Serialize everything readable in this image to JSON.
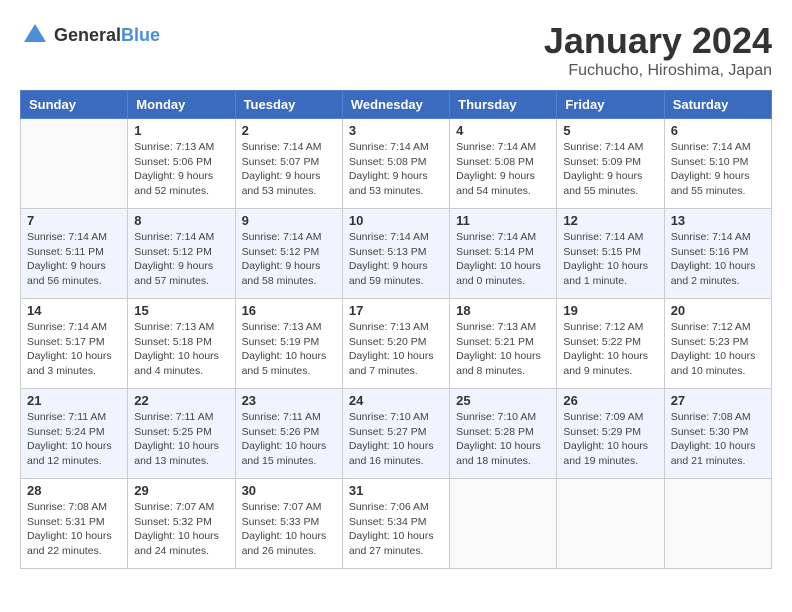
{
  "logo": {
    "text_general": "General",
    "text_blue": "Blue"
  },
  "title": "January 2024",
  "location": "Fuchucho, Hiroshima, Japan",
  "days_of_week": [
    "Sunday",
    "Monday",
    "Tuesday",
    "Wednesday",
    "Thursday",
    "Friday",
    "Saturday"
  ],
  "weeks": [
    [
      {
        "day": "",
        "info": ""
      },
      {
        "day": "1",
        "info": "Sunrise: 7:13 AM\nSunset: 5:06 PM\nDaylight: 9 hours\nand 52 minutes."
      },
      {
        "day": "2",
        "info": "Sunrise: 7:14 AM\nSunset: 5:07 PM\nDaylight: 9 hours\nand 53 minutes."
      },
      {
        "day": "3",
        "info": "Sunrise: 7:14 AM\nSunset: 5:08 PM\nDaylight: 9 hours\nand 53 minutes."
      },
      {
        "day": "4",
        "info": "Sunrise: 7:14 AM\nSunset: 5:08 PM\nDaylight: 9 hours\nand 54 minutes."
      },
      {
        "day": "5",
        "info": "Sunrise: 7:14 AM\nSunset: 5:09 PM\nDaylight: 9 hours\nand 55 minutes."
      },
      {
        "day": "6",
        "info": "Sunrise: 7:14 AM\nSunset: 5:10 PM\nDaylight: 9 hours\nand 55 minutes."
      }
    ],
    [
      {
        "day": "7",
        "info": "Sunrise: 7:14 AM\nSunset: 5:11 PM\nDaylight: 9 hours\nand 56 minutes."
      },
      {
        "day": "8",
        "info": "Sunrise: 7:14 AM\nSunset: 5:12 PM\nDaylight: 9 hours\nand 57 minutes."
      },
      {
        "day": "9",
        "info": "Sunrise: 7:14 AM\nSunset: 5:12 PM\nDaylight: 9 hours\nand 58 minutes."
      },
      {
        "day": "10",
        "info": "Sunrise: 7:14 AM\nSunset: 5:13 PM\nDaylight: 9 hours\nand 59 minutes."
      },
      {
        "day": "11",
        "info": "Sunrise: 7:14 AM\nSunset: 5:14 PM\nDaylight: 10 hours\nand 0 minutes."
      },
      {
        "day": "12",
        "info": "Sunrise: 7:14 AM\nSunset: 5:15 PM\nDaylight: 10 hours\nand 1 minute."
      },
      {
        "day": "13",
        "info": "Sunrise: 7:14 AM\nSunset: 5:16 PM\nDaylight: 10 hours\nand 2 minutes."
      }
    ],
    [
      {
        "day": "14",
        "info": "Sunrise: 7:14 AM\nSunset: 5:17 PM\nDaylight: 10 hours\nand 3 minutes."
      },
      {
        "day": "15",
        "info": "Sunrise: 7:13 AM\nSunset: 5:18 PM\nDaylight: 10 hours\nand 4 minutes."
      },
      {
        "day": "16",
        "info": "Sunrise: 7:13 AM\nSunset: 5:19 PM\nDaylight: 10 hours\nand 5 minutes."
      },
      {
        "day": "17",
        "info": "Sunrise: 7:13 AM\nSunset: 5:20 PM\nDaylight: 10 hours\nand 7 minutes."
      },
      {
        "day": "18",
        "info": "Sunrise: 7:13 AM\nSunset: 5:21 PM\nDaylight: 10 hours\nand 8 minutes."
      },
      {
        "day": "19",
        "info": "Sunrise: 7:12 AM\nSunset: 5:22 PM\nDaylight: 10 hours\nand 9 minutes."
      },
      {
        "day": "20",
        "info": "Sunrise: 7:12 AM\nSunset: 5:23 PM\nDaylight: 10 hours\nand 10 minutes."
      }
    ],
    [
      {
        "day": "21",
        "info": "Sunrise: 7:11 AM\nSunset: 5:24 PM\nDaylight: 10 hours\nand 12 minutes."
      },
      {
        "day": "22",
        "info": "Sunrise: 7:11 AM\nSunset: 5:25 PM\nDaylight: 10 hours\nand 13 minutes."
      },
      {
        "day": "23",
        "info": "Sunrise: 7:11 AM\nSunset: 5:26 PM\nDaylight: 10 hours\nand 15 minutes."
      },
      {
        "day": "24",
        "info": "Sunrise: 7:10 AM\nSunset: 5:27 PM\nDaylight: 10 hours\nand 16 minutes."
      },
      {
        "day": "25",
        "info": "Sunrise: 7:10 AM\nSunset: 5:28 PM\nDaylight: 10 hours\nand 18 minutes."
      },
      {
        "day": "26",
        "info": "Sunrise: 7:09 AM\nSunset: 5:29 PM\nDaylight: 10 hours\nand 19 minutes."
      },
      {
        "day": "27",
        "info": "Sunrise: 7:08 AM\nSunset: 5:30 PM\nDaylight: 10 hours\nand 21 minutes."
      }
    ],
    [
      {
        "day": "28",
        "info": "Sunrise: 7:08 AM\nSunset: 5:31 PM\nDaylight: 10 hours\nand 22 minutes."
      },
      {
        "day": "29",
        "info": "Sunrise: 7:07 AM\nSunset: 5:32 PM\nDaylight: 10 hours\nand 24 minutes."
      },
      {
        "day": "30",
        "info": "Sunrise: 7:07 AM\nSunset: 5:33 PM\nDaylight: 10 hours\nand 26 minutes."
      },
      {
        "day": "31",
        "info": "Sunrise: 7:06 AM\nSunset: 5:34 PM\nDaylight: 10 hours\nand 27 minutes."
      },
      {
        "day": "",
        "info": ""
      },
      {
        "day": "",
        "info": ""
      },
      {
        "day": "",
        "info": ""
      }
    ]
  ]
}
